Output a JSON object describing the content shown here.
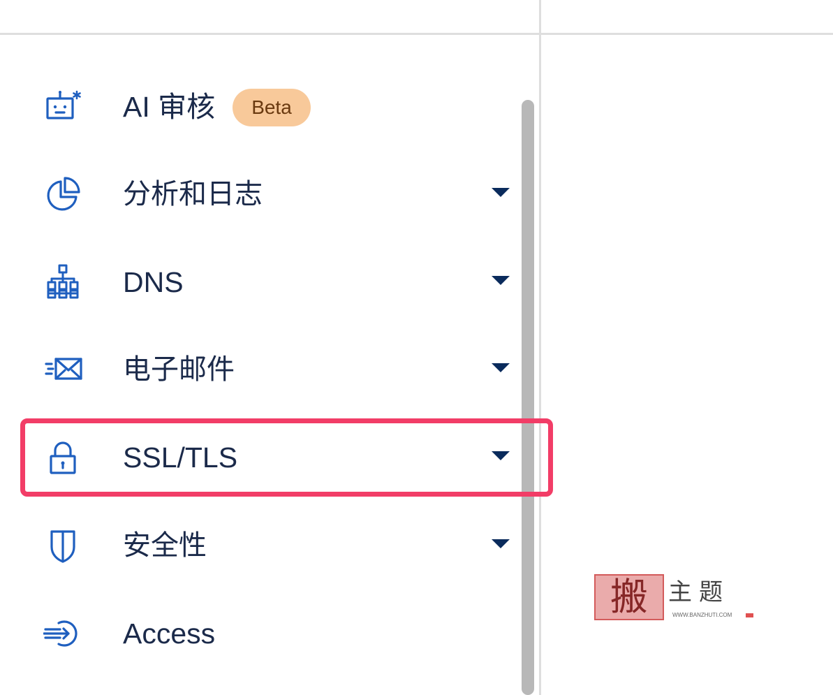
{
  "sidebar": {
    "items": [
      {
        "label": "AI 审核",
        "icon": "robot-icon",
        "badge": "Beta",
        "expandable": false
      },
      {
        "label": "分析和日志",
        "icon": "pie-chart-icon",
        "expandable": true
      },
      {
        "label": "DNS",
        "icon": "network-tree-icon",
        "expandable": true
      },
      {
        "label": "电子邮件",
        "icon": "envelope-icon",
        "expandable": true
      },
      {
        "label": "SSL/TLS",
        "icon": "lock-icon",
        "expandable": true,
        "highlighted": true
      },
      {
        "label": "安全性",
        "icon": "shield-icon",
        "expandable": true
      },
      {
        "label": "Access",
        "icon": "access-arrow-icon",
        "expandable": false
      }
    ]
  },
  "watermark": {
    "stamp_char": "搬",
    "text": "主题",
    "url": "WWW.BANZHUTI.COM"
  },
  "colors": {
    "icon": "#1f5fbf",
    "label": "#1b2a4a",
    "chevron": "#0a2b5c",
    "badge_bg": "#f8c99a",
    "badge_text": "#6a3a10",
    "highlight": "#f23d67",
    "scrollbar": "#b8b8b8",
    "divider": "#dedede"
  }
}
